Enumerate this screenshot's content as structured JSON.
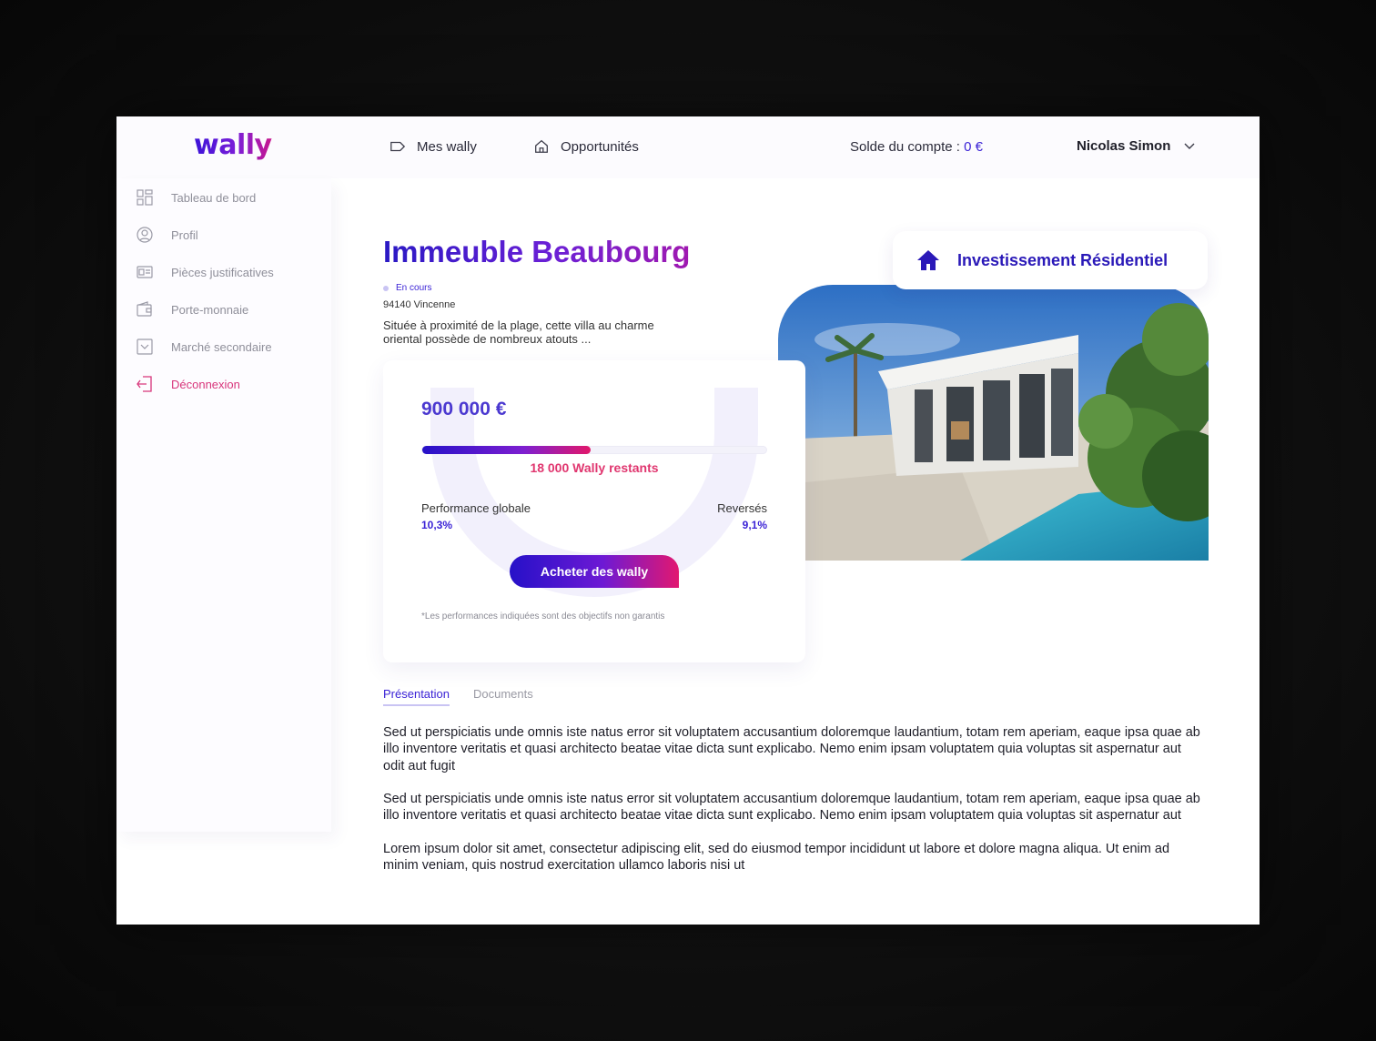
{
  "brand": {
    "logo": "wally"
  },
  "header": {
    "nav": [
      {
        "label": "Mes wally",
        "icon": "tag-icon"
      },
      {
        "label": "Opportunités",
        "icon": "home-outline-icon"
      }
    ],
    "balance_label": "Solde du compte : ",
    "balance_value": "0 €",
    "user_name": "Nicolas Simon"
  },
  "sidebar": {
    "items": [
      {
        "label": "Tableau de bord",
        "icon": "dashboard-icon"
      },
      {
        "label": "Profil",
        "icon": "user-circle-icon"
      },
      {
        "label": "Pièces justificatives",
        "icon": "id-card-icon"
      },
      {
        "label": "Porte-monnaie",
        "icon": "wallet-icon"
      },
      {
        "label": "Marché secondaire",
        "icon": "market-icon"
      },
      {
        "label": "Déconnexion",
        "icon": "logout-icon"
      }
    ]
  },
  "property": {
    "title": "Immeuble Beaubourg",
    "status": "En cours",
    "city": "94140 Vincenne",
    "description": "Située à proximité de la plage, cette villa au charme oriental possède de nombreux atouts ...",
    "category": "Investissement Résidentiel"
  },
  "card": {
    "price": "900 000 €",
    "progress": 0.49,
    "remaining": "18 000 Wally restants",
    "perf_label": "Performance globale",
    "perf_value": "10,3%",
    "rev_label": "Reversés",
    "rev_value": "9,1%",
    "buy_label": "Acheter des wally",
    "disclaimer": "*Les performances indiquées sont des objectifs non garantis"
  },
  "tabs": [
    {
      "label": "Présentation",
      "active": true
    },
    {
      "label": "Documents",
      "active": false
    }
  ],
  "content": {
    "p1": "Sed ut perspiciatis unde omnis iste natus error sit voluptatem accusantium doloremque laudantium, totam rem aperiam, eaque ipsa quae ab illo inventore veritatis et quasi architecto beatae vitae dicta sunt explicabo. Nemo enim ipsam voluptatem quia voluptas sit aspernatur aut odit aut fugit",
    "p2": "Sed ut perspiciatis unde omnis iste natus error sit voluptatem accusantium doloremque laudantium, totam rem aperiam, eaque ipsa quae ab illo inventore veritatis et quasi architecto beatae vitae dicta sunt explicabo. Nemo enim ipsam voluptatem quia voluptas sit aspernatur aut",
    "p3": "Lorem ipsum dolor sit amet, consectetur adipiscing elit, sed do eiusmod tempor incididunt ut labore et dolore magna aliqua. Ut enim ad minim veniam, quis nostrud exercitation ullamco laboris nisi ut"
  },
  "colors": {
    "accent": "#3b23d6",
    "pink": "#e0366f",
    "logout": "#d8357b"
  }
}
